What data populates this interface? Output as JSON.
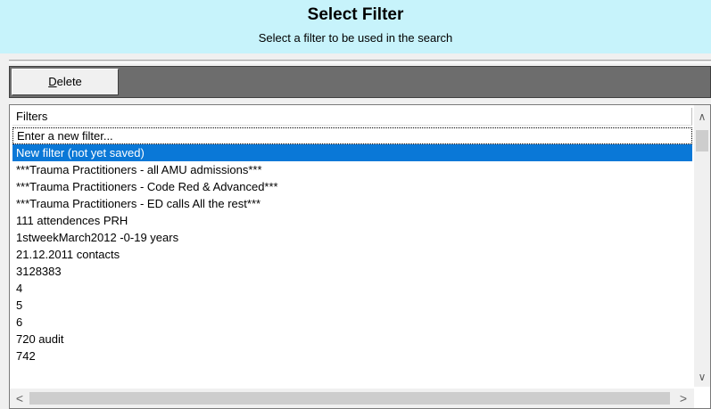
{
  "header": {
    "title": "Select Filter",
    "subtitle": "Select a filter to be used in the search"
  },
  "toolbar": {
    "delete_label": "Delete",
    "delete_mnemonic": "D",
    "delete_rest": "elete"
  },
  "list": {
    "column_header": "Filters",
    "selected_index": 1,
    "items": [
      "Enter a new filter...",
      "New filter (not yet saved)",
      "***Trauma Practitioners - all AMU admissions***",
      "***Trauma Practitioners - Code Red & Advanced***",
      "***Trauma Practitioners - ED calls All the rest***",
      "111 attendences PRH",
      "1stweekMarch2012 -0-19 years",
      "21.12.2011 contacts",
      "3128383",
      "4",
      "5",
      "6",
      "720 audit",
      "742"
    ]
  },
  "scrollbars": {
    "up_icon": "chevron-up-icon",
    "down_icon": "chevron-down-icon",
    "left_icon": "chevron-left-icon",
    "right_icon": "chevron-right-icon"
  }
}
